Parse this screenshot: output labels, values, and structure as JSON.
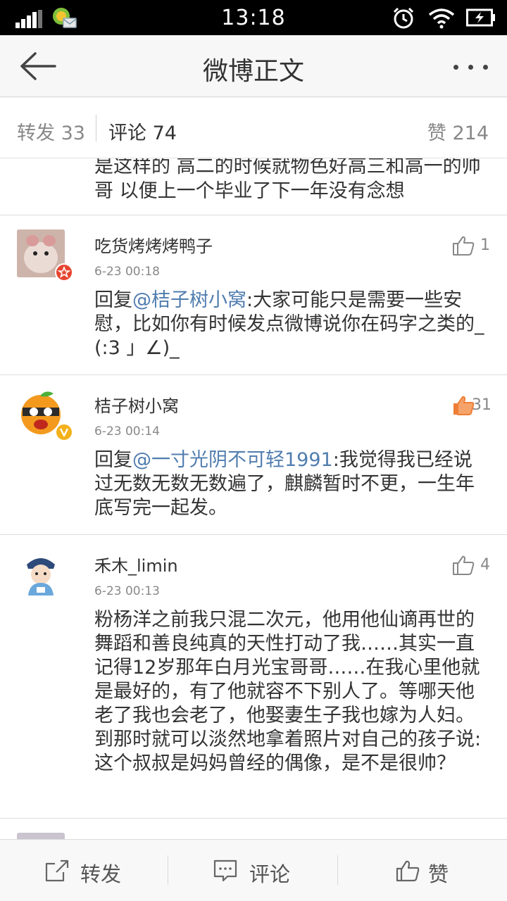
{
  "status_bar": {
    "time": "13:18"
  },
  "header": {
    "title": "微博正文"
  },
  "tabs": {
    "repost": "转发 33",
    "comments": "评论 74",
    "likes": "赞 214"
  },
  "partial_comment": {
    "text": "是这样的 高二的时候就物色好高三和高一的帅哥 以便上一个毕业了下一年没有念想"
  },
  "comments": [
    {
      "name": "吃货烤烤烤鸭子",
      "time": "6-23 00:18",
      "prefix": "回复",
      "mention": "@桔子树小窝",
      "text": ":大家可能只是需要一些安慰，比如你有时候发点微博说你在码字之类的_ (:3 」∠)_",
      "likes": "1"
    },
    {
      "name": "桔子树小窝",
      "time": "6-23 00:14",
      "prefix": "回复",
      "mention": "@一寸光阴不可轻1991",
      "text": ":我觉得我已经说过无数无数无数遍了，麒麟暂时不更，一生年底写完一起发。",
      "likes": "31"
    },
    {
      "name": "禾木_limin",
      "time": "6-23 00:13",
      "text": "粉杨洋之前我只混二次元，他用他仙谪再世的舞蹈和善良纯真的天性打动了我……其实一直记得12岁那年白月光宝哥哥……在我心里他就是最好的，有了他就容不下别人了。等哪天他老了我也会老了，他娶妻生子我也嫁为人妇。到那时就可以淡然地拿着照片对自己的孩子说:这个叔叔是妈妈曾经的偶像，是不是很帅？",
      "likes": "4"
    }
  ],
  "toolbar": {
    "repost": "转发",
    "comment": "评论",
    "like": "赞"
  },
  "colors": {
    "link": "#507daf",
    "liked": "#ef7d35",
    "vip_badge": "#f2b11b",
    "member_badge": "#e7452f"
  }
}
